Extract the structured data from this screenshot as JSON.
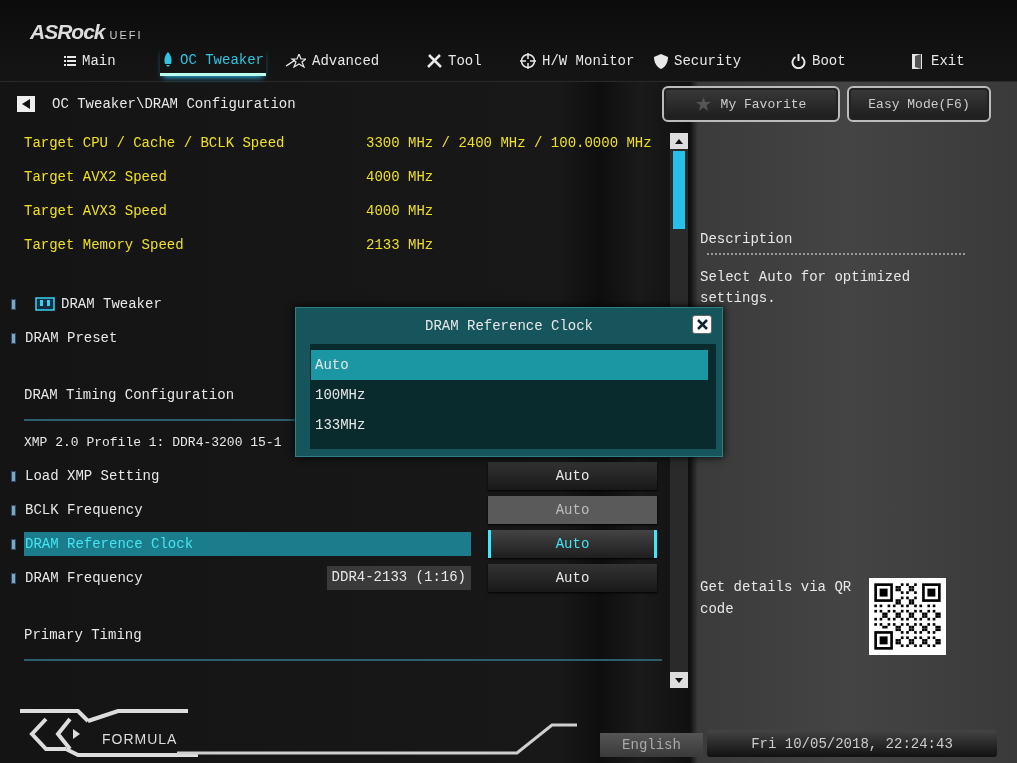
{
  "brand": {
    "name": "ASRock",
    "suffix": "UEFI"
  },
  "tabs": [
    {
      "label": "Main",
      "selected": false
    },
    {
      "label": "OC Tweaker",
      "selected": true
    },
    {
      "label": "Advanced",
      "selected": false
    },
    {
      "label": "Tool",
      "selected": false
    },
    {
      "label": "H/W Monitor",
      "selected": false
    },
    {
      "label": "Security",
      "selected": false
    },
    {
      "label": "Boot",
      "selected": false
    },
    {
      "label": "Exit",
      "selected": false
    }
  ],
  "breadcrumb": "OC Tweaker\\DRAM Configuration",
  "buttons": [
    {
      "label": "My Favorite"
    },
    {
      "label": "Easy Mode(F6)"
    }
  ],
  "targets": [
    {
      "label": "Target CPU / Cache / BCLK Speed",
      "value": "3300 MHz / 2400 MHz / 100.0000 MHz"
    },
    {
      "label": "Target AVX2 Speed",
      "value": "4000 MHz"
    },
    {
      "label": "Target AVX3 Speed",
      "value": "4000 MHz"
    },
    {
      "label": "Target Memory Speed",
      "value": "2133 MHz"
    }
  ],
  "items": [
    {
      "kind": "section",
      "label": "DRAM Tweaker"
    },
    {
      "kind": "setting",
      "label": "DRAM Preset",
      "selected": false
    },
    {
      "kind": "heading",
      "label": "DRAM Timing Configuration"
    },
    {
      "kind": "info",
      "label": "XMP 2.0 Profile 1: DDR4-3200 15-1"
    },
    {
      "kind": "setting",
      "label": "Load XMP Setting",
      "value": "Auto",
      "selected": false,
      "disabled": false
    },
    {
      "kind": "setting",
      "label": "BCLK Frequency",
      "value": "Auto",
      "selected": false,
      "disabled": true
    },
    {
      "kind": "setting",
      "label": "DRAM Reference Clock",
      "value": "Auto",
      "selected": true,
      "disabled": false
    },
    {
      "kind": "setting",
      "label": "DRAM Frequency",
      "note": "DDR4-2133 (1:16)",
      "value": "Auto",
      "selected": false,
      "disabled": false
    },
    {
      "kind": "heading",
      "label": "Primary Timing"
    }
  ],
  "description": {
    "title": "Description",
    "text": "Select Auto for optimized settings."
  },
  "qr": {
    "text": "Get details via QR code"
  },
  "footer": {
    "logo_text": "FORMULA",
    "language": "English",
    "datetime": "Fri 10/05/2018, 22:24:43"
  },
  "dialog": {
    "title": "DRAM Reference Clock",
    "options": [
      {
        "label": "Auto",
        "selected": true
      },
      {
        "label": "100MHz",
        "selected": false
      },
      {
        "label": "133MHz",
        "selected": false
      }
    ]
  }
}
